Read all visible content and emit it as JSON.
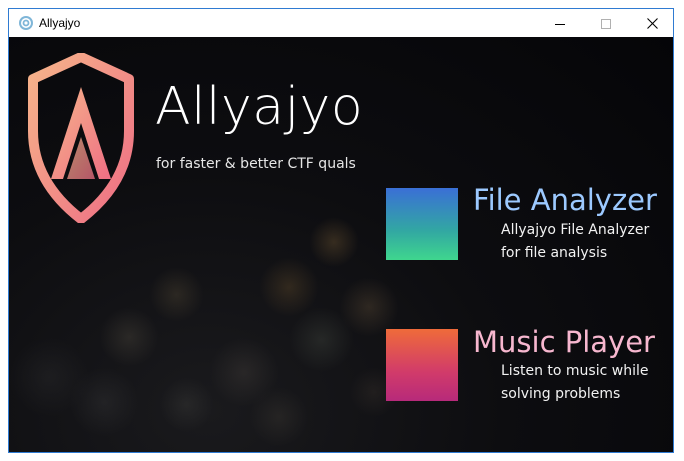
{
  "window": {
    "title": "Allyajyo",
    "app_icon": "gear-icon",
    "controls": {
      "minimize_icon": "minimize-icon",
      "maximize_icon": "maximize-icon",
      "close_icon": "close-icon"
    }
  },
  "brand": {
    "name": "Allyajyo",
    "tagline": "for faster & better CTF quals",
    "logo_icon": "shield-a-logo",
    "logo_colors": [
      "#f6b48a",
      "#ee6e84"
    ]
  },
  "features": {
    "file_analyzer": {
      "title": "File Analyzer",
      "description_line1": "Allyajyo File Analyzer",
      "description_line2": "for file analysis",
      "title_color": "#9cc9ff",
      "tile_colors": [
        "#3a6fd6",
        "#3fd68e"
      ]
    },
    "music_player": {
      "title": "Music Player",
      "description_line1": "Listen to music while",
      "description_line2": "solving problems",
      "title_color": "#f7b7cf",
      "tile_colors": [
        "#ef6b3a",
        "#b72a7a"
      ]
    }
  },
  "colors": {
    "window_border": "#2f7bd2",
    "background_dark": "#0d0d10"
  }
}
